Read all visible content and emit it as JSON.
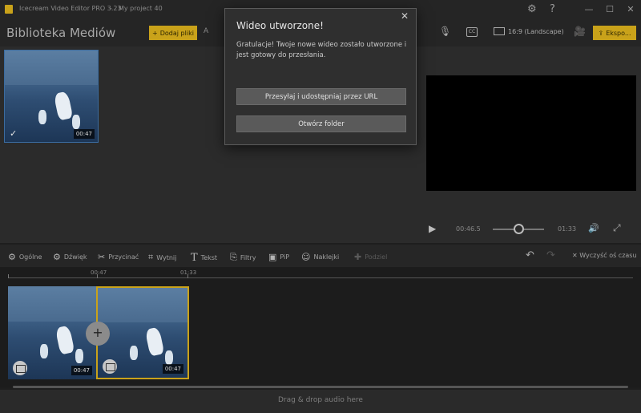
{
  "titlebar": {
    "app_title": "Icecream Video Editor PRO 3.23",
    "separator": "-",
    "project": "My project 40",
    "minimize": "—",
    "maximize": "☐",
    "close": "✕"
  },
  "header": {
    "media_title": "Biblioteka Mediów",
    "add_files_label": "Dodaj pliki",
    "a_label": "A",
    "ratio_label": "16:9 (Landscape)",
    "export_label": "Ekspo..."
  },
  "media": {
    "thumb_duration": "00:47"
  },
  "preview": {
    "current_time": "00:46.5",
    "total_time": "01:33"
  },
  "toolbar": {
    "general": "Ogólne",
    "sound": "Dźwięk",
    "trim": "Przycinać",
    "crop": "Wytnij",
    "text": "Tekst",
    "filters": "Filtry",
    "pip": "PiP",
    "stickers": "Naklejki",
    "split": "Podziel",
    "clear_timeline": "Wyczyść oś czasu"
  },
  "timeline": {
    "mark_1": "00:47",
    "mark_2": "01:33",
    "clip1_duration": "00:47",
    "clip2_duration": "00:47",
    "audio_hint": "Drag & drop audio here"
  },
  "dialog": {
    "title": "Wideo utworzone!",
    "message": "Gratulacje! Twoje nowe wideo zostało utworzone i jest gotowy do przesłania.",
    "upload_button": "Przesyłaj i udostępniaj przez URL",
    "open_folder_button": "Otwórz folder"
  },
  "colors": {
    "accent": "#c9a21a",
    "selection": "#3b6ca0"
  }
}
